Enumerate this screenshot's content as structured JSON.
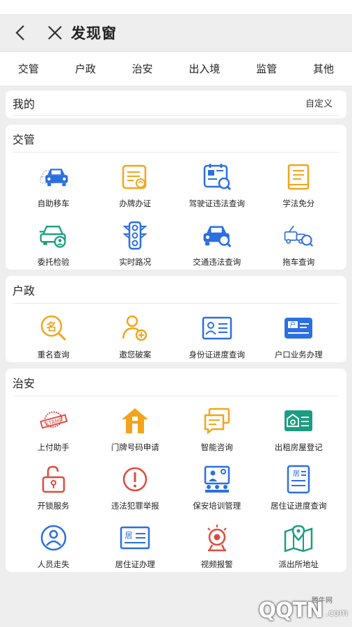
{
  "header": {
    "title": "发现窗"
  },
  "tabs": [
    "交管",
    "户政",
    "治安",
    "出入境",
    "监管",
    "其他"
  ],
  "mine": {
    "title": "我的",
    "custom_label": "自定义"
  },
  "jiaoguan": {
    "title": "交管",
    "items": [
      {
        "label": "自助移车",
        "icon": "car-move-icon"
      },
      {
        "label": "办牌办证",
        "icon": "license-card-icon"
      },
      {
        "label": "驾驶证违法查询",
        "icon": "driver-license-search-icon"
      },
      {
        "label": "学法免分",
        "icon": "book-icon"
      },
      {
        "label": "委托检验",
        "icon": "car-inspection-icon"
      },
      {
        "label": "实时路况",
        "icon": "traffic-light-icon"
      },
      {
        "label": "交通违法查询",
        "icon": "car-search-icon"
      },
      {
        "label": "拖车查询",
        "icon": "tow-truck-icon"
      }
    ]
  },
  "huzheng": {
    "title": "户政",
    "items": [
      {
        "label": "重名查询",
        "icon": "name-search-icon"
      },
      {
        "label": "邀您破案",
        "icon": "user-add-icon"
      },
      {
        "label": "身份证进度查询",
        "icon": "id-card-icon"
      },
      {
        "label": "户口业务办理",
        "icon": "household-card-icon"
      }
    ]
  },
  "zhian": {
    "title": "治安",
    "items": [
      {
        "label": "上付助手",
        "icon": "stamp-icon"
      },
      {
        "label": "门牌号码申请",
        "icon": "house-icon"
      },
      {
        "label": "智能咨询",
        "icon": "chat-icon"
      },
      {
        "label": "出租房屋登记",
        "icon": "rental-house-icon"
      },
      {
        "label": "开锁服务",
        "icon": "lock-icon"
      },
      {
        "label": "违法犯罪举报",
        "icon": "alert-icon"
      },
      {
        "label": "保安培训管理",
        "icon": "training-icon"
      },
      {
        "label": "居住证进度查询",
        "icon": "residence-permit-icon"
      },
      {
        "label": "人员走失",
        "icon": "missing-person-icon"
      },
      {
        "label": "居住证办理",
        "icon": "residence-card-icon"
      },
      {
        "label": "视频报警",
        "icon": "camera-icon"
      },
      {
        "label": "派出所地址",
        "icon": "map-location-icon"
      }
    ]
  },
  "watermark": {
    "small": "腾牛网",
    "logo": "QQTN",
    "suffix": ".com"
  }
}
